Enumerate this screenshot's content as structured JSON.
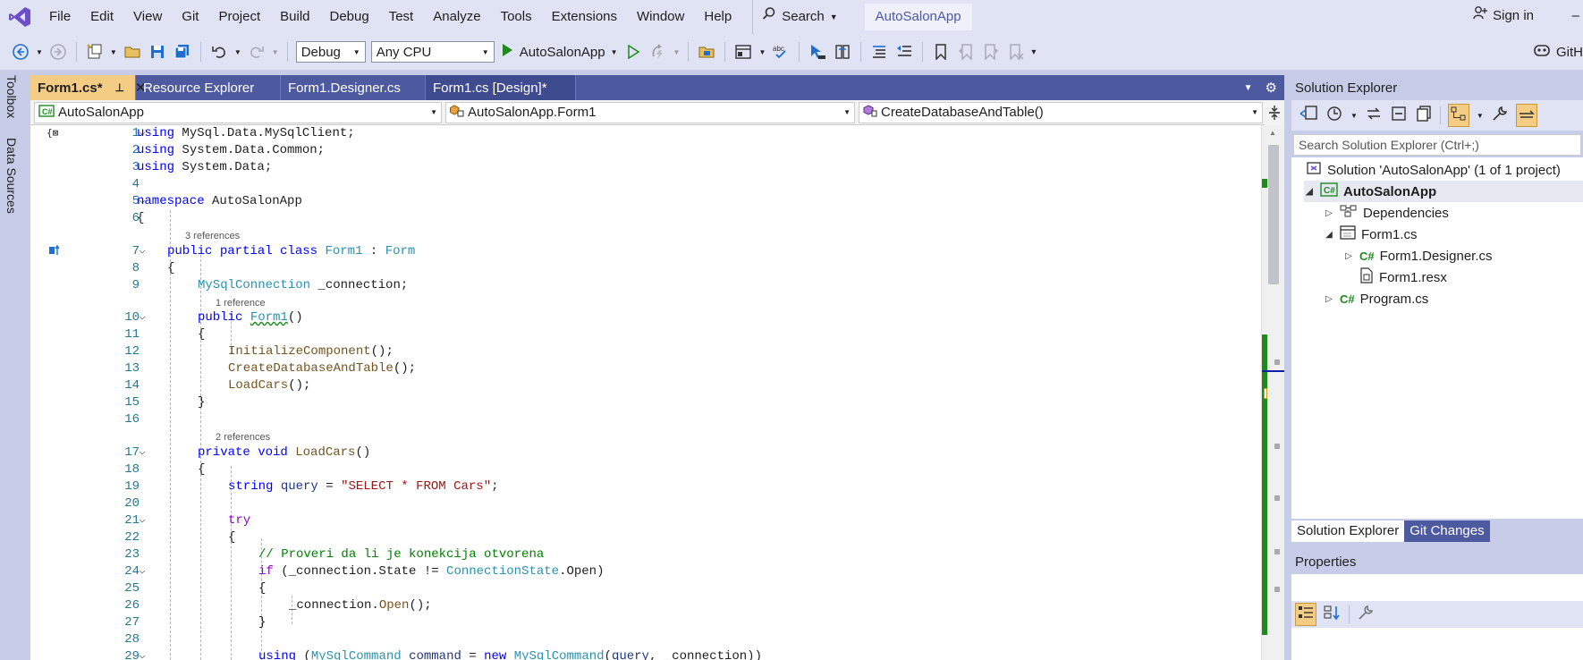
{
  "menu": {
    "items": [
      "File",
      "Edit",
      "View",
      "Git",
      "Project",
      "Build",
      "Debug",
      "Test",
      "Analyze",
      "Tools",
      "Extensions",
      "Window",
      "Help"
    ],
    "search_label": "Search",
    "app_title": "AutoSalonApp",
    "signin_label": "Sign in",
    "minimize_label": "–"
  },
  "toolbar": {
    "config": "Debug",
    "platform": "Any CPU",
    "start_label": "AutoSalonApp",
    "copilot_label": "GitH"
  },
  "side_tabs": {
    "toolbox": "Toolbox",
    "data_sources": "Data Sources"
  },
  "editor": {
    "tabs": [
      {
        "label": "Form1.cs*",
        "active": true
      },
      {
        "label": "Resource Explorer",
        "active": false
      },
      {
        "label": "Form1.Designer.cs",
        "active": false
      },
      {
        "label": "Form1.cs [Design]*",
        "active": false
      }
    ],
    "nav": {
      "project": "AutoSalonApp",
      "type": "AutoSalonApp.Form1",
      "member": "CreateDatabaseAndTable()"
    },
    "codelens": {
      "class_refs": "3 references",
      "ctor_refs": "1 reference",
      "loadcars_refs": "2 references"
    },
    "line_numbers": [
      "1",
      "2",
      "3",
      "4",
      "5",
      "6",
      "7",
      "8",
      "9",
      "10",
      "11",
      "12",
      "13",
      "14",
      "15",
      "16",
      "17",
      "18",
      "19",
      "20",
      "21",
      "22",
      "23",
      "24",
      "25",
      "26",
      "27",
      "28",
      "29"
    ]
  },
  "solution_explorer": {
    "title": "Solution Explorer",
    "search_placeholder": "Search Solution Explorer (Ctrl+;)",
    "solution_label": "Solution 'AutoSalonApp' (1 of 1 project)",
    "project_label": "AutoSalonApp",
    "dependencies_label": "Dependencies",
    "form1_label": "Form1.cs",
    "designer_label": "Form1.Designer.cs",
    "resx_label": "Form1.resx",
    "program_label": "Program.cs",
    "tab_solution": "Solution Explorer",
    "tab_git": "Git Changes"
  },
  "properties": {
    "title": "Properties"
  },
  "colors": {
    "accent": "#4d5aa0",
    "active_tab": "#f5cc84",
    "menu_bg": "#dfe3f3",
    "keyword": "#0000ff",
    "type": "#2b91af",
    "string": "#a31515",
    "comment": "#008000"
  }
}
